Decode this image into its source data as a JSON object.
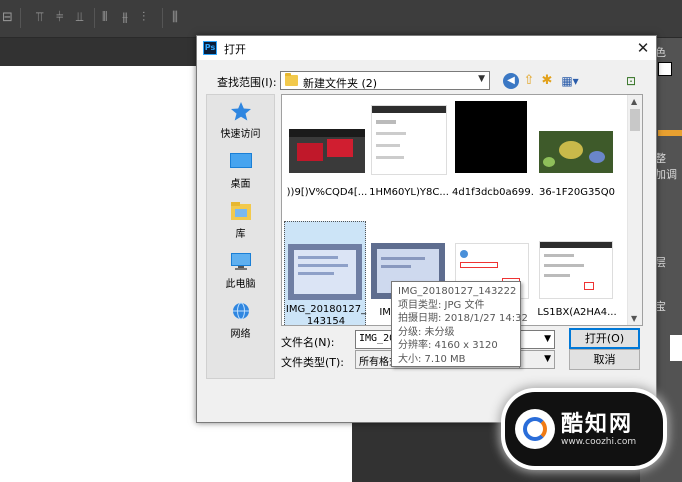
{
  "dialog": {
    "title": "打开",
    "app_logo": "Ps",
    "close_glyph": "✕"
  },
  "toolbar": {
    "look_in_label": "查找范围(I):",
    "look_in_value": "新建文件夹 (2)",
    "icons": [
      "back-arrow-icon",
      "up-folder-icon",
      "new-folder-icon",
      "view-menu-icon",
      "desktop-folder-icon"
    ]
  },
  "places": [
    {
      "label": "快速访问",
      "icon": "star-icon"
    },
    {
      "label": "桌面",
      "icon": "desktop-icon"
    },
    {
      "label": "库",
      "icon": "library-icon"
    },
    {
      "label": "此电脑",
      "icon": "computer-icon"
    },
    {
      "label": "网络",
      "icon": "network-icon"
    }
  ],
  "files": [
    {
      "label": "))9[)V%CQD4[..."
    },
    {
      "label": "1HM60YL)Y8C..."
    },
    {
      "label": "4d1f3dcb0a699..."
    },
    {
      "label": "36-1F20G35Q0"
    },
    {
      "label": "IMG_20180127_143154",
      "selected": true
    },
    {
      "label": "IMG_2018..."
    },
    {
      "label": "..."
    },
    {
      "label": "LS1BX(A2HA4..."
    }
  ],
  "bottom": {
    "filename_label": "文件名(N):",
    "filename_value": "IMG_20180127_143154",
    "filetype_label": "文件类型(T):",
    "filetype_value": "所有格式",
    "open_button": "打开(O)",
    "cancel_button": "取消"
  },
  "tooltip": {
    "lines": [
      "IMG_20180127_143222",
      "项目类型: JPG 文件",
      "拍摄日期: 2018/1/27 14:32",
      "分级: 未分级",
      "分辨率: 4160 x 3120",
      "大小: 7.10 MB"
    ]
  },
  "photoshop": {
    "panel_labels": [
      "色",
      "整",
      "加调",
      "层",
      "宝"
    ]
  },
  "watermark": {
    "title": "酷知网",
    "url": "www.coozhi.com"
  },
  "colors": {
    "selection": "#cce4f7",
    "accent": "#0078d7",
    "ps_dark": "#323232"
  }
}
